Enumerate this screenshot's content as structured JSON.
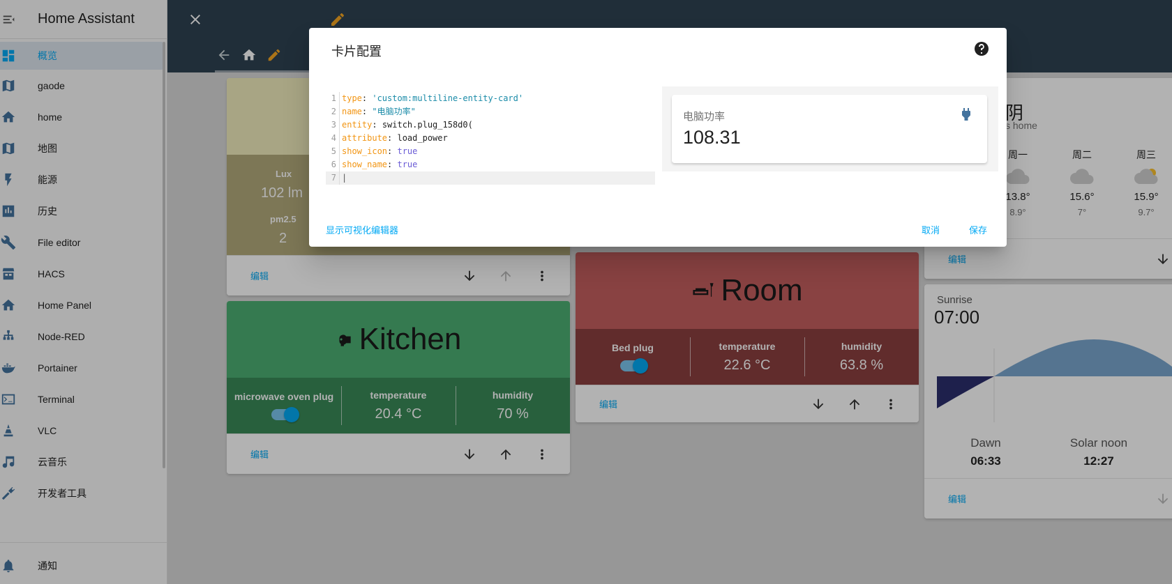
{
  "sidebar": {
    "title": "Home Assistant",
    "items": [
      {
        "label": "概览",
        "icon": "dashboard-icon"
      },
      {
        "label": "gaode",
        "icon": "map-icon"
      },
      {
        "label": "home",
        "icon": "home-icon"
      },
      {
        "label": "地图",
        "icon": "map-icon"
      },
      {
        "label": "能源",
        "icon": "lightning-icon"
      },
      {
        "label": "历史",
        "icon": "chart-icon"
      },
      {
        "label": "File editor",
        "icon": "wrench-icon"
      },
      {
        "label": "HACS",
        "icon": "hacs-icon"
      },
      {
        "label": "Home Panel",
        "icon": "home-icon"
      },
      {
        "label": "Node-RED",
        "icon": "sitemap-icon"
      },
      {
        "label": "Portainer",
        "icon": "docker-icon"
      },
      {
        "label": "Terminal",
        "icon": "console-icon"
      },
      {
        "label": "VLC",
        "icon": "vlc-icon"
      },
      {
        "label": "云音乐",
        "icon": "music-icon"
      },
      {
        "label": "开发者工具",
        "icon": "hammer-icon"
      }
    ],
    "notifications": "通知"
  },
  "sensor_card": {
    "lux_label": "Lux",
    "lux_value": "102 lm",
    "pm_label": "pm2.5",
    "pm_value": "2",
    "edit": "编辑"
  },
  "kitchen_card": {
    "title": "Kitchen",
    "cols": [
      {
        "label": "microwave oven plug",
        "value": ""
      },
      {
        "label": "temperature",
        "value": "20.4 °C"
      },
      {
        "label": "humidity",
        "value": "70 %"
      }
    ],
    "edit": "编辑"
  },
  "room_card": {
    "title": "Room",
    "cols": [
      {
        "label": "Bed plug",
        "value": ""
      },
      {
        "label": "temperature",
        "value": "22.6 °C"
      },
      {
        "label": "humidity",
        "value": "63.8 %"
      }
    ],
    "edit": "编辑"
  },
  "weather_card": {
    "title": "阴",
    "subtitle": "s home",
    "forecast": [
      {
        "day": "周一",
        "hi": "13.8°",
        "lo": "8.9°"
      },
      {
        "day": "周二",
        "hi": "15.6°",
        "lo": "7°"
      },
      {
        "day": "周三",
        "hi": "15.9°",
        "lo": "9.7°"
      }
    ],
    "edit": "编辑"
  },
  "sun_card": {
    "label": "Sunrise",
    "time": "07:00",
    "dawn_label": "Dawn",
    "dawn_time": "06:33",
    "noon_label": "Solar noon",
    "noon_time": "12:27",
    "edit": "编辑"
  },
  "dialog": {
    "title": "卡片配置",
    "code_lines": [
      {
        "num": "1",
        "key": "type",
        "val": "'custom:multiline-entity-card'",
        "vtype": "s"
      },
      {
        "num": "2",
        "key": "name",
        "val": "\"电脑功率\"",
        "vtype": "s"
      },
      {
        "num": "3",
        "key": "entity",
        "val": "switch.plug_158d0(",
        "vtype": "p"
      },
      {
        "num": "4",
        "key": "attribute",
        "val": "load_power",
        "vtype": "p"
      },
      {
        "num": "5",
        "key": "show_icon",
        "val": "true",
        "vtype": "b"
      },
      {
        "num": "6",
        "key": "show_name",
        "val": "true",
        "vtype": "b"
      },
      {
        "num": "7",
        "key": "",
        "val": "",
        "vtype": "p"
      }
    ],
    "preview_name": "电脑功率",
    "preview_value": "108.31",
    "show_visual_editor": "显示可视化编辑器",
    "cancel": "取消",
    "save": "保存"
  },
  "colors": {
    "accent": "#03a9f4",
    "header": "#2f4352",
    "kitchen": "#4caf73",
    "room": "#c45f5f"
  }
}
